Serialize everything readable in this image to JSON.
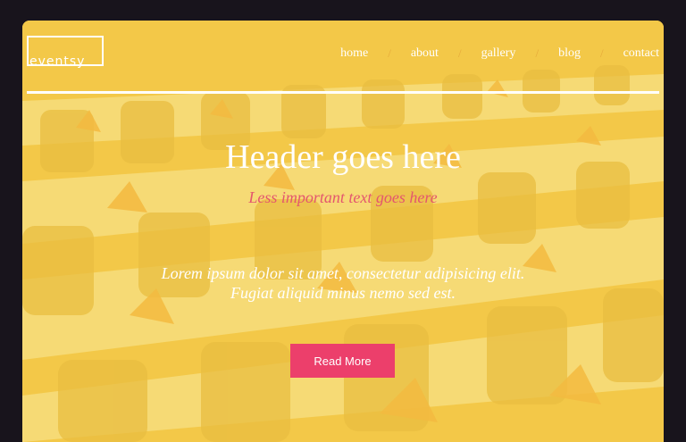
{
  "brand": {
    "logo_text": "eventsy"
  },
  "nav": {
    "items": [
      {
        "label": "home"
      },
      {
        "label": "about"
      },
      {
        "label": "gallery"
      },
      {
        "label": "blog"
      },
      {
        "label": "contact"
      }
    ],
    "separator": "/"
  },
  "hero": {
    "title": "Header goes here",
    "subtitle": "Less important text goes here",
    "body": "Lorem ipsum dolor sit amet, consectetur adipisicing elit. Fugiat aliquid minus nemo sed est.",
    "cta_label": "Read More"
  },
  "colors": {
    "frame": "#18141c",
    "overlay_yellow": "#f6ce46",
    "accent_pink": "#ec3f6b",
    "subtitle_pink": "#e4566e",
    "separator_orange": "#e6a93a",
    "text": "#ffffff"
  }
}
